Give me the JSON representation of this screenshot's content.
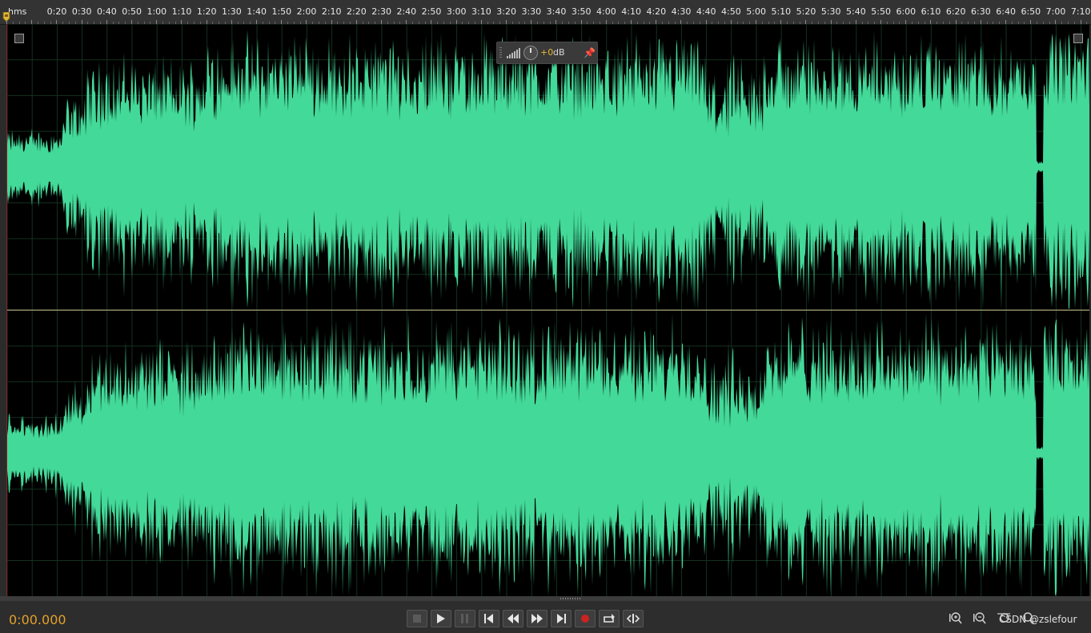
{
  "ruler": {
    "unit": "hms",
    "labels": [
      "0:20",
      "0:30",
      "0:40",
      "0:50",
      "1:00",
      "1:10",
      "1:20",
      "1:30",
      "1:40",
      "1:50",
      "2:00",
      "2:10",
      "2:20",
      "2:30",
      "2:40",
      "2:50",
      "3:00",
      "3:10",
      "3:20",
      "3:30",
      "3:40",
      "3:50",
      "4:00",
      "4:10",
      "4:20",
      "4:30",
      "4:40",
      "4:50",
      "5:00",
      "5:10",
      "5:20",
      "5:30",
      "5:40",
      "5:50",
      "6:00",
      "6:10",
      "6:20",
      "6:30",
      "6:40",
      "6:50",
      "7:00",
      "7:10"
    ]
  },
  "waveform": {
    "color": "#43d999",
    "background": "#000000",
    "channels": 2
  },
  "hud": {
    "value": "+0",
    "unit": "dB",
    "icons": [
      "level-bars-icon",
      "volume-knob-icon",
      "pin-icon"
    ]
  },
  "transport": {
    "time": "0:00.000",
    "buttons": [
      "stop-button",
      "play-button",
      "pause-button",
      "go-to-start-button",
      "rewind-button",
      "fast-forward-button",
      "go-to-end-button",
      "record-button",
      "loop-button",
      "skip-selection-button"
    ]
  },
  "zoom": {
    "buttons": [
      "zoom-in-icon",
      "zoom-out-icon",
      "zoom-full-icon",
      "zoom-selection-icon"
    ]
  },
  "watermark": "CSDN @zslefour",
  "colors": {
    "accent_time": "#e3a12a",
    "record": "#cc2222",
    "ruler_bg": "#333333"
  }
}
